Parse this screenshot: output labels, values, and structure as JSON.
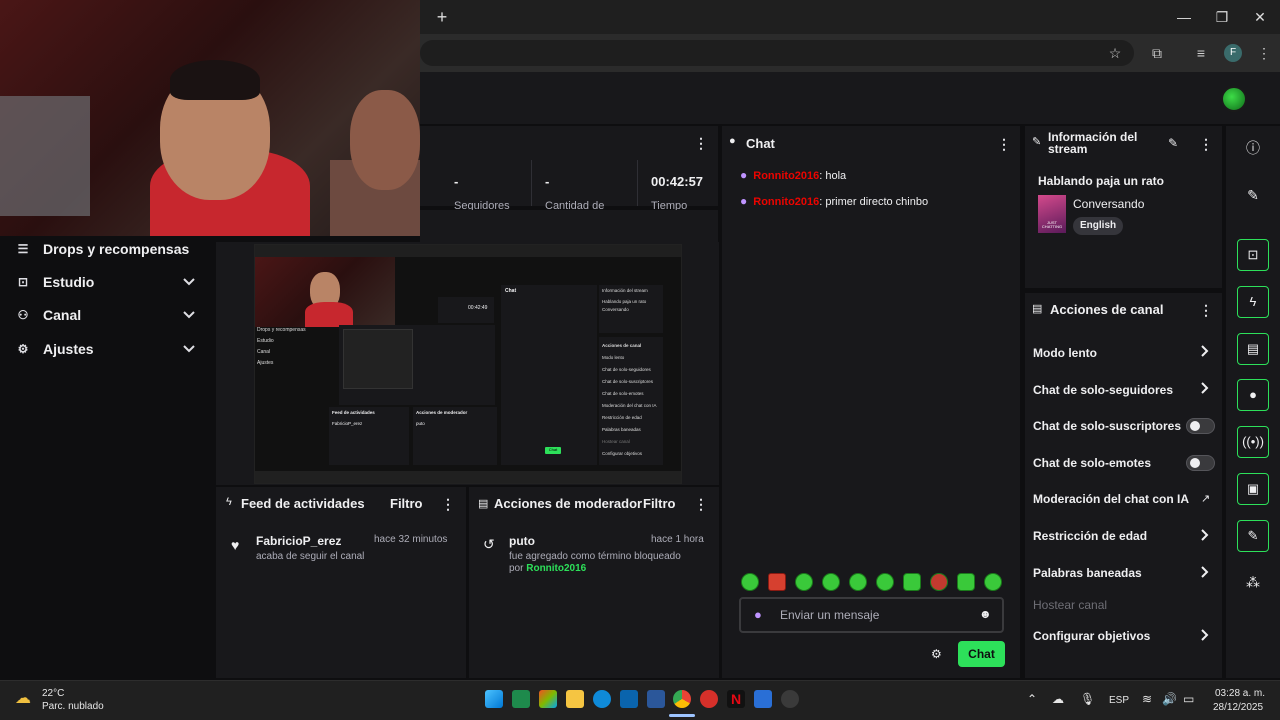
{
  "browser": {
    "new_tab": "+",
    "minimize": "—",
    "maximize": "❐",
    "close": "✕",
    "profile_initial": "F"
  },
  "stats": {
    "dash1": "-",
    "dash2": "-",
    "timer": "00:42:57",
    "label1": "Seguidores",
    "label2": "Cantidad de",
    "label3": "Tiempo"
  },
  "sidebar": {
    "items": [
      {
        "label": "Drops y recompensas",
        "icon": "gift-icon"
      },
      {
        "label": "Estudio",
        "icon": "camera-icon"
      },
      {
        "label": "Canal",
        "icon": "users-icon"
      },
      {
        "label": "Ajustes",
        "icon": "gear-icon"
      }
    ]
  },
  "chat": {
    "title": "Chat",
    "messages": [
      {
        "user": "Ronnito2016",
        "text": ": hola"
      },
      {
        "user": "Ronnito2016",
        "text": ": primer directo chinbo"
      }
    ],
    "placeholder": "Enviar un mensaje",
    "send_label": "Chat"
  },
  "stream_info": {
    "title_line1": "Información del",
    "title_line2": "stream",
    "stream_title": "Hablando paja un rato",
    "category": "Conversando",
    "tag": "English",
    "boxart_text": "JUST CHATTING"
  },
  "channel_actions": {
    "title": "Acciones de canal",
    "items": [
      {
        "label": "Modo lento",
        "control": "chevron"
      },
      {
        "label": "Chat de solo-seguidores",
        "control": "chevron"
      },
      {
        "label": "Chat de solo-suscriptores",
        "control": "toggle"
      },
      {
        "label": "Chat de solo-emotes",
        "control": "toggle"
      },
      {
        "label": "Moderación del chat con IA",
        "control": "external"
      },
      {
        "label": "Restricción de edad",
        "control": "chevron"
      },
      {
        "label": "Palabras baneadas",
        "control": "chevron"
      },
      {
        "label": "Hostear canal",
        "control": "disabled"
      },
      {
        "label": "Configurar objetivos",
        "control": "chevron"
      }
    ]
  },
  "activity_feed": {
    "title": "Feed de actividades",
    "filter": "Filtro",
    "entry_user": "FabricioP_erez",
    "entry_time": "hace 32 minutos",
    "entry_text": "acaba de seguir el canal"
  },
  "mod_actions": {
    "title": "Acciones de moderador",
    "filter": "Filtro",
    "entry_term": "puto",
    "entry_time": "hace 1 hora",
    "entry_text": "fue agregado como término bloqueado",
    "entry_by": "por",
    "entry_mod": "Ronnito2016"
  },
  "preview": {
    "mini_sidebar": [
      "Drops y recompensas",
      "Estudio",
      "Canal",
      "Ajustes"
    ],
    "mini_chat_title": "Chat",
    "mini_info_title": "Información del stream",
    "mini_stream_title": "Hablando paja un rato",
    "mini_category": "Conversando",
    "mini_actions_title": "Acciones de canal",
    "mini_actions": [
      "Modo lento",
      "Chat de solo-seguidores",
      "Chat de solo-suscriptores",
      "Chat de solo-emotes",
      "Moderación del chat con IA",
      "Restricción de edad",
      "Palabras baneadas",
      "Hostear canal",
      "Configurar objetivos"
    ],
    "mini_feed_title": "Feed de actividades",
    "mini_mod_title": "Acciones de moderador",
    "mini_feed_user": "FabricioP_erez",
    "mini_mod_term": "puto",
    "mini_send": "Chat",
    "mini_timer": "00:42:49"
  },
  "taskbar": {
    "temperature": "22°C",
    "weather": "Parc. nublado",
    "language": "ESP",
    "time": "03:28 a. m.",
    "date": "28/12/2025"
  },
  "colors": {
    "accent": "#2de05a",
    "username": "#eb0400",
    "background": "#0e0e10",
    "panel": "#18181b"
  }
}
